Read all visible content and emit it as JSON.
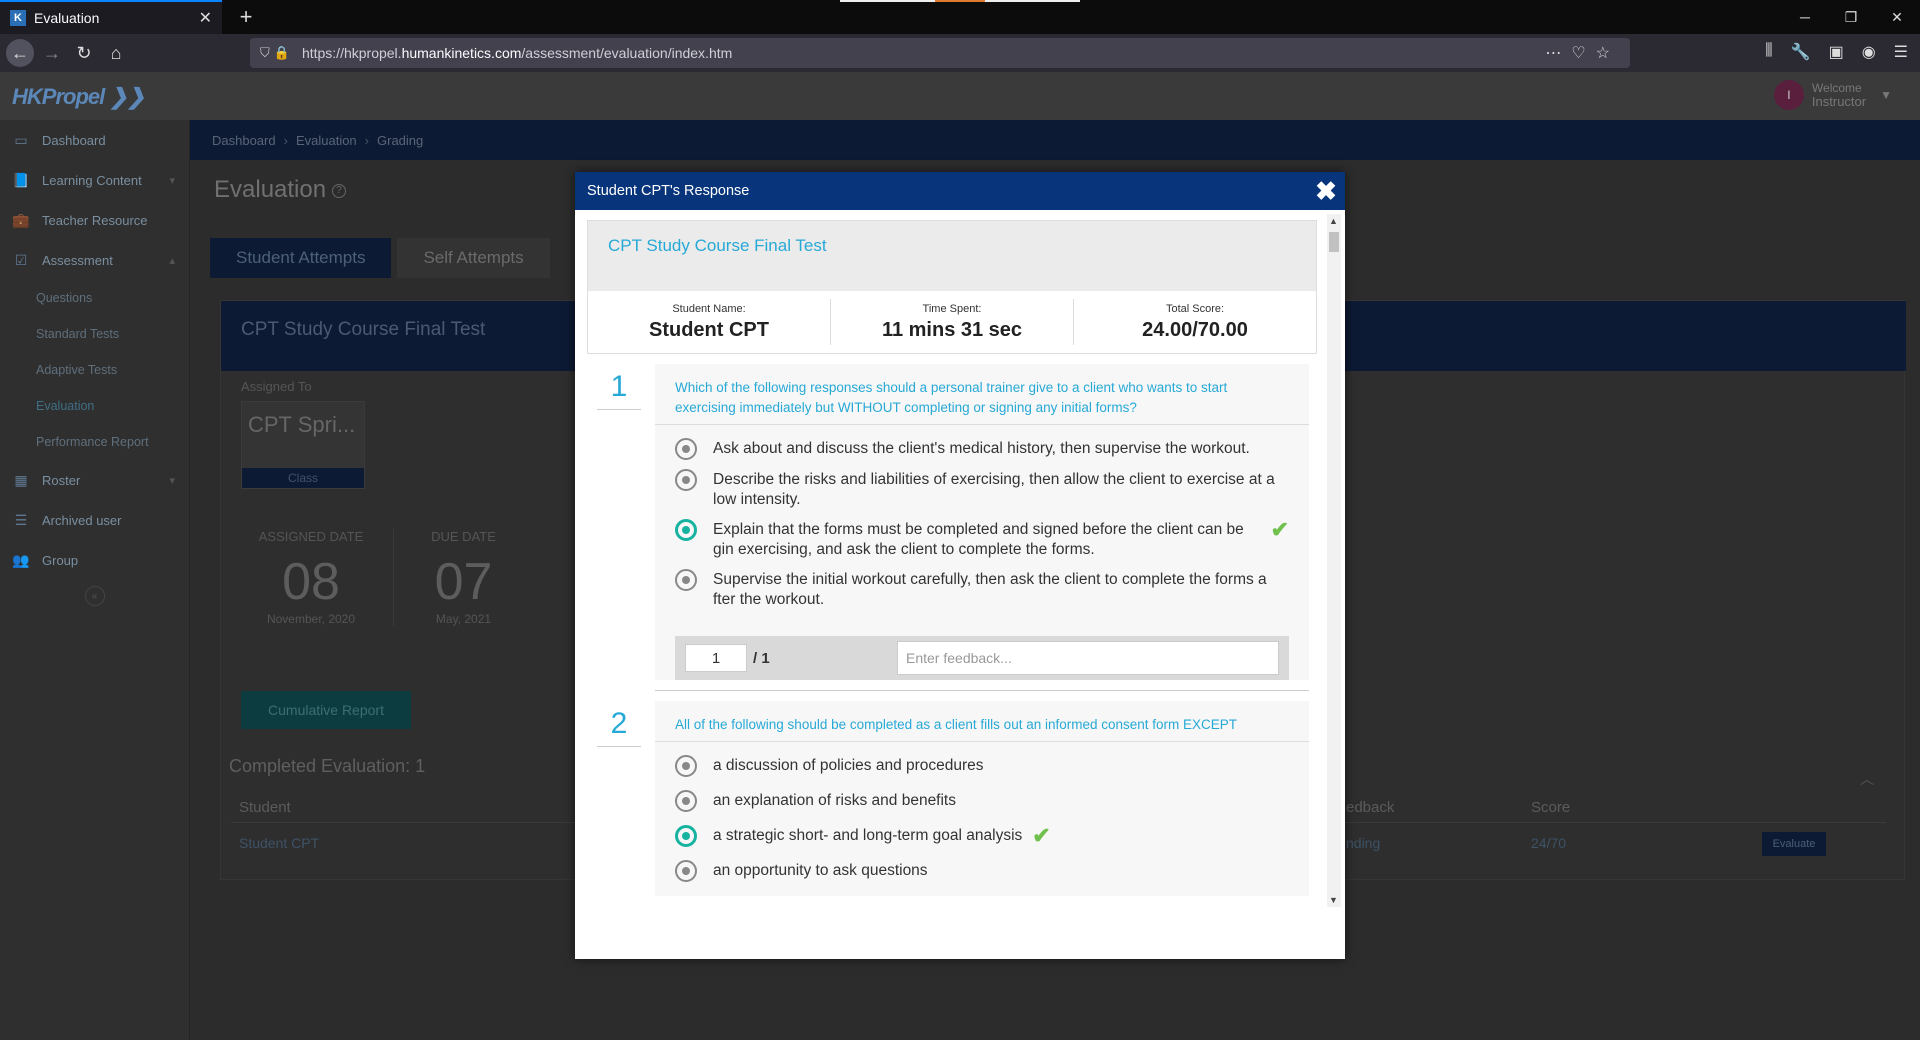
{
  "browser": {
    "tab_title": "Evaluation",
    "tab_favicon": "K",
    "url_prefix": "https://hkpropel.",
    "url_host": "humankinetics.com",
    "url_path": "/assessment/evaluation/index.htm"
  },
  "header": {
    "logo": "HKPropel",
    "avatar_initial": "I",
    "welcome": "Welcome",
    "user_role": "Instructor"
  },
  "sidebar": {
    "items": [
      {
        "label": "Dashboard",
        "icon": "monitor-icon"
      },
      {
        "label": "Learning Content",
        "icon": "book-icon"
      },
      {
        "label": "Teacher Resource",
        "icon": "briefcase-icon"
      },
      {
        "label": "Assessment",
        "icon": "checkbox-icon"
      }
    ],
    "subitems": [
      "Questions",
      "Standard Tests",
      "Adaptive Tests",
      "Evaluation",
      "Performance Report"
    ],
    "items2": [
      {
        "label": "Roster",
        "icon": "calendar-icon"
      },
      {
        "label": "Archived user",
        "icon": "list-icon"
      },
      {
        "label": "Group",
        "icon": "group-icon"
      }
    ]
  },
  "main": {
    "breadcrumb": [
      "Dashboard",
      "Evaluation",
      "Grading"
    ],
    "page_title": "Evaluation",
    "tabs": [
      "Student Attempts",
      "Self Attempts"
    ],
    "panel_title": "CPT Study Course Final Test",
    "assigned_to": "Assigned To",
    "class_name": "CPT Spri...",
    "class_label": "Class",
    "assigned_date": {
      "label": "ASSIGNED DATE",
      "day": "08",
      "month": "November, 2020"
    },
    "due_date": {
      "label": "DUE DATE",
      "day": "07",
      "month": "May, 2021"
    },
    "cumulative_btn": "Cumulative Report",
    "completed": "Completed Evaluation: 1",
    "table_headers": {
      "student": "Student",
      "feedback": "edback",
      "score": "Score"
    },
    "row": {
      "student": "Student CPT",
      "feedback": "nding",
      "score": "24/70",
      "action": "Evaluate"
    }
  },
  "modal": {
    "title": "Student CPT's Response",
    "test_name": "CPT Study Course Final Test",
    "stats": [
      {
        "label": "Student Name:",
        "value": "Student CPT"
      },
      {
        "label": "Time Spent:",
        "value": "11 mins 31 sec"
      },
      {
        "label": "Total Score:",
        "value": "24.00/70.00"
      }
    ],
    "questions": [
      {
        "number": "1",
        "text": "Which of the following responses should a personal trainer give to a client who wants to start exercising immediately but WITHOUT completing or signing any initial forms?",
        "options": [
          "Ask about and discuss the client's medical history, then supervise the workout.",
          "Describe the risks and liabilities of exercising, then allow the client to exercise at a low intensity.",
          "Explain that the forms must be completed and signed before the client can be gin exercising, and ask the client to complete the forms.",
          "Supervise the initial workout carefully, then ask the client to complete the forms a fter the workout."
        ],
        "selected": 2,
        "score": "1",
        "max": "/ 1",
        "feedback_placeholder": "Enter feedback..."
      },
      {
        "number": "2",
        "text": "All of the following should be completed as a client fills out an informed consent form EXCEPT",
        "options": [
          "a discussion of policies and procedures",
          "an explanation of risks and benefits",
          "a strategic short- and long-term goal analysis",
          "an opportunity to ask questions"
        ],
        "selected": 2
      }
    ]
  },
  "colors": {
    "modal_header": "#07347a",
    "accent_text": "#27a9d6",
    "selected_radio": "#17b3a1",
    "check": "#6fc04c"
  }
}
